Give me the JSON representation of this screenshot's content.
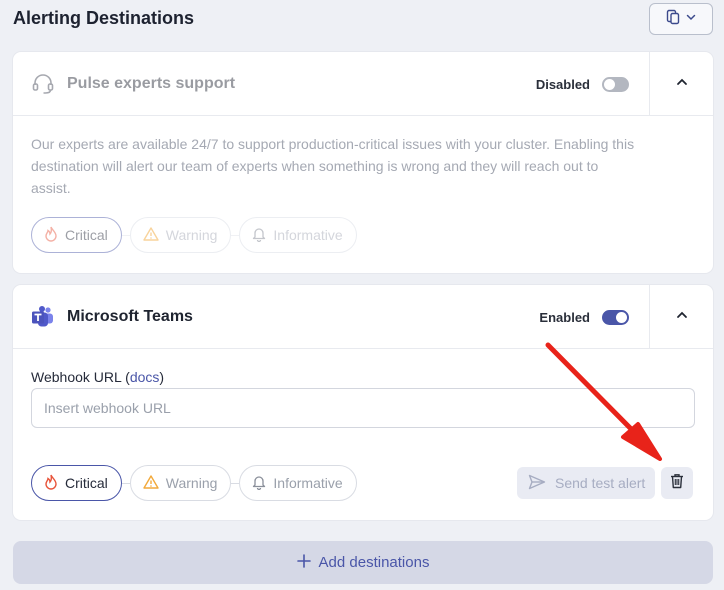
{
  "header": {
    "title": "Alerting Destinations"
  },
  "destinations": [
    {
      "name": "Pulse experts support",
      "status": "Disabled",
      "enabled": false,
      "icon": "headset-icon",
      "description": "Our experts are available 24/7 to support production-critical issues with your cluster. Enabling this destination will alert our team of experts when something is wrong and they will reach out to assist.",
      "severities": [
        "Critical",
        "Warning",
        "Informative"
      ]
    },
    {
      "name": "Microsoft Teams",
      "status": "Enabled",
      "enabled": true,
      "icon": "microsoft-teams-icon",
      "webhook_label": "Webhook URL",
      "webhook_docs": "docs",
      "webhook_placeholder": "Insert webhook URL",
      "webhook_value": "",
      "severities": [
        "Critical",
        "Warning",
        "Informative"
      ],
      "send_test_label": "Send test alert"
    }
  ],
  "add_destinations_label": "Add destinations",
  "colors": {
    "accent": "#4a56a8",
    "critical": "#e8553b",
    "warning": "#f2a93b",
    "annotation_arrow": "#e8231a"
  }
}
